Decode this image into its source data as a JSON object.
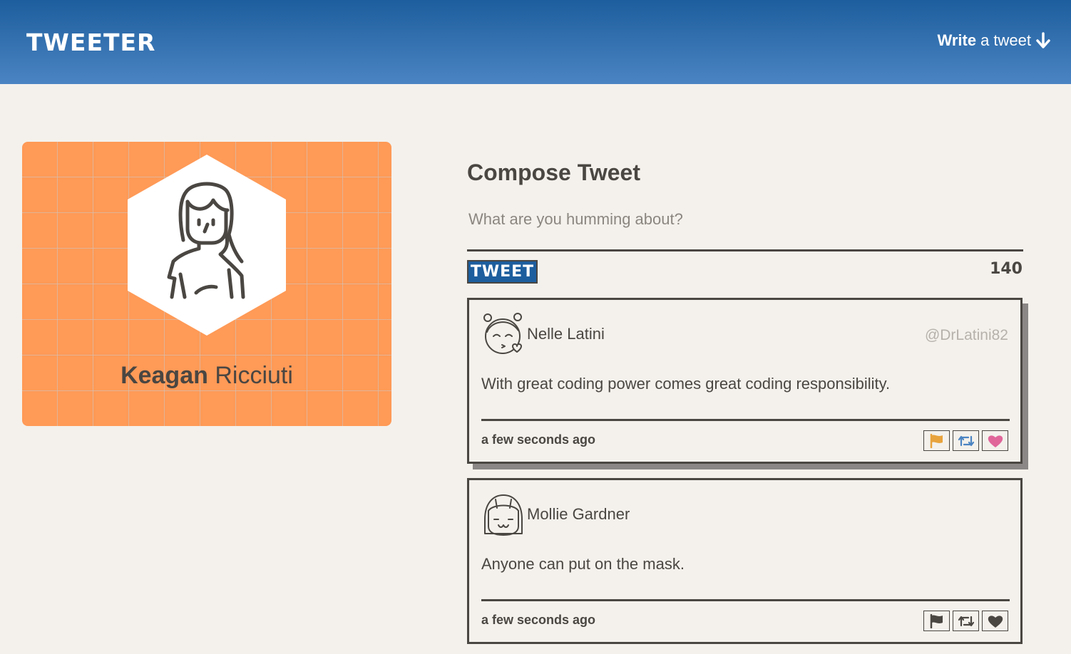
{
  "nav": {
    "brand": "TWEETER",
    "write_bold": "Write",
    "write_rest": "a tweet"
  },
  "profile": {
    "first_name": "Keagan",
    "last_name": "Ricciuti",
    "card_color": "#ff9a57"
  },
  "compose": {
    "title": "Compose Tweet",
    "placeholder": "What are you humming about?",
    "button_label": "TWEET",
    "counter": "140"
  },
  "tweets": [
    {
      "name": "Nelle Latini",
      "handle": "@DrLatini82",
      "text": "With great coding power comes great coding responsibility.",
      "time": "a few seconds ago",
      "hovered": true,
      "icons": [
        "flag-icon",
        "retweet-icon",
        "heart-icon"
      ]
    },
    {
      "name": "Mollie Gardner",
      "handle": "",
      "text": "Anyone can put on the mask.",
      "time": "a few seconds ago",
      "hovered": false,
      "icons": [
        "flag-icon",
        "retweet-icon",
        "heart-icon"
      ]
    }
  ],
  "colors": {
    "nav_top": "#1d5e9e",
    "nav_bottom": "#4b84c2",
    "text": "#4a4642",
    "background": "#f4f1ec",
    "flag_hover": "#e8a33d",
    "retweet_hover": "#4b84c2",
    "heart_hover": "#e0669a"
  }
}
